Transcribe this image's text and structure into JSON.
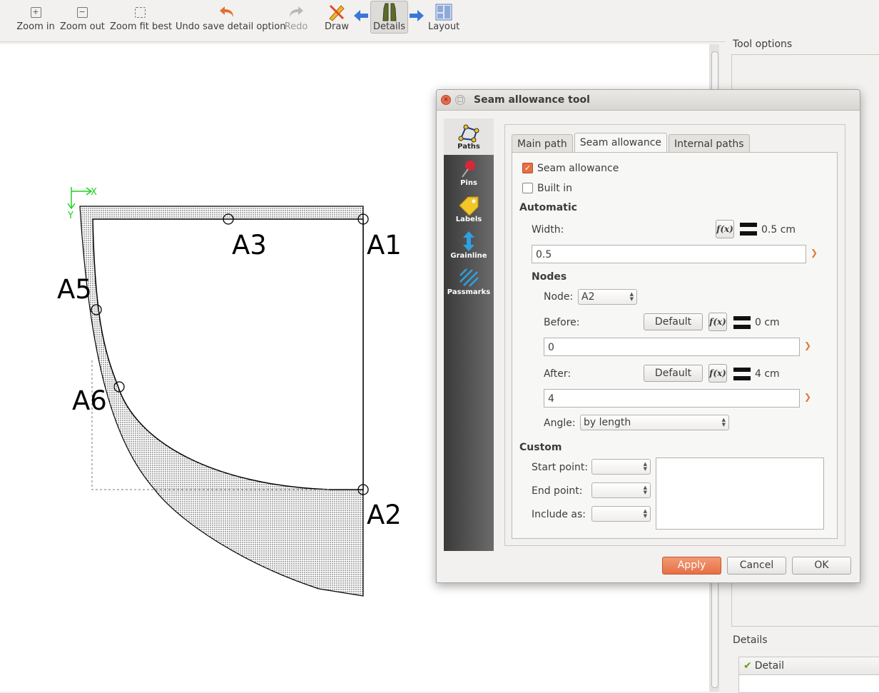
{
  "toolbar": {
    "zoom_in": "Zoom in",
    "zoom_out": "Zoom out",
    "zoom_fit": "Zoom fit best",
    "undo": "Undo save detail option",
    "redo": "Redo",
    "draw": "Draw",
    "details": "Details",
    "layout": "Layout"
  },
  "canvas": {
    "axis_x": "X",
    "axis_y": "Y",
    "points": {
      "a1": "A1",
      "a2": "A2",
      "a3": "A3",
      "a5": "A5",
      "a6": "A6"
    }
  },
  "right_panel": {
    "tool_options": "Tool options",
    "details_title": "Details",
    "details_column": "Detail"
  },
  "dialog": {
    "title": "Seam allowance tool",
    "sidebar": [
      "Paths",
      "Pins",
      "Labels",
      "Grainline",
      "Passmarks"
    ],
    "tabs": [
      "Main path",
      "Seam allowance",
      "Internal paths"
    ],
    "seam_allowance_label": "Seam allowance",
    "seam_allowance_checked": true,
    "built_in_label": "Built in",
    "built_in_checked": false,
    "automatic": "Automatic",
    "width_label": "Width:",
    "width_value": "0.5 cm",
    "width_formula": "0.5",
    "nodes": "Nodes",
    "node_label": "Node:",
    "node_value": "A2",
    "before_label": "Before:",
    "before_default": "Default",
    "before_value": "0 cm",
    "before_formula": "0",
    "after_label": "After:",
    "after_default": "Default",
    "after_value": "4 cm",
    "after_formula": "4",
    "angle_label": "Angle:",
    "angle_value": "by length",
    "custom": "Custom",
    "start_point": "Start point:",
    "end_point": "End point:",
    "include_as": "Include as:",
    "fx_label": "f(x)",
    "apply": "Apply",
    "cancel": "Cancel",
    "ok": "OK"
  }
}
